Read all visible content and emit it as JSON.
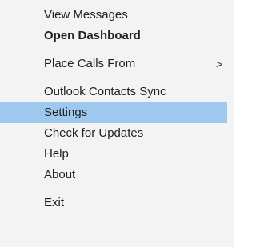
{
  "menu": {
    "items": [
      {
        "label": "View Messages"
      },
      {
        "label": "Open Dashboard"
      },
      {
        "label": "Place Calls From",
        "submenu_indicator": ">"
      },
      {
        "label": "Outlook Contacts Sync"
      },
      {
        "label": "Settings"
      },
      {
        "label": "Check for Updates"
      },
      {
        "label": "Help"
      },
      {
        "label": "About"
      },
      {
        "label": "Exit"
      }
    ],
    "selected_item": "Settings",
    "colors": {
      "background": "#f3f3f3",
      "highlight": "#9ec8ee",
      "separator": "#d6d6d6",
      "text": "#1f1f1f"
    }
  }
}
